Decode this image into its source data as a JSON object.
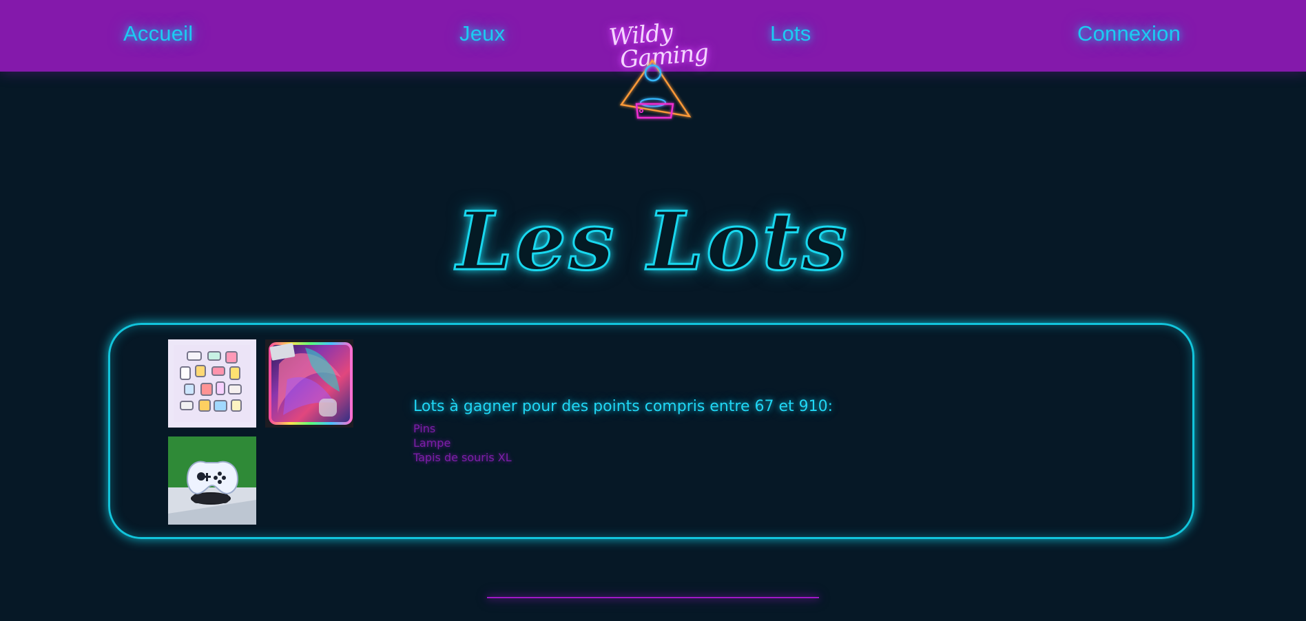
{
  "nav": {
    "items": [
      "Accueil",
      "Jeux",
      "Lots",
      "Connexion"
    ]
  },
  "logo": {
    "line1": "Wildy",
    "line2": "Gaming",
    "icon": "joystick-icon"
  },
  "hero": {
    "title": "Les Lots"
  },
  "prizes": {
    "heading": "Lots à gagner pour des points compris entre 67 et 910:",
    "items": [
      "Pins",
      "Lampe",
      "Tapis de souris XL"
    ]
  },
  "images": [
    {
      "alt": "pins-image"
    },
    {
      "alt": "mouse-pad-image"
    },
    {
      "alt": "controller-lamp-image"
    }
  ],
  "colors": {
    "background": "#061826",
    "topbar": "#8419ab",
    "cyan": "#19d8ef",
    "purple": "#7d1ea8"
  }
}
